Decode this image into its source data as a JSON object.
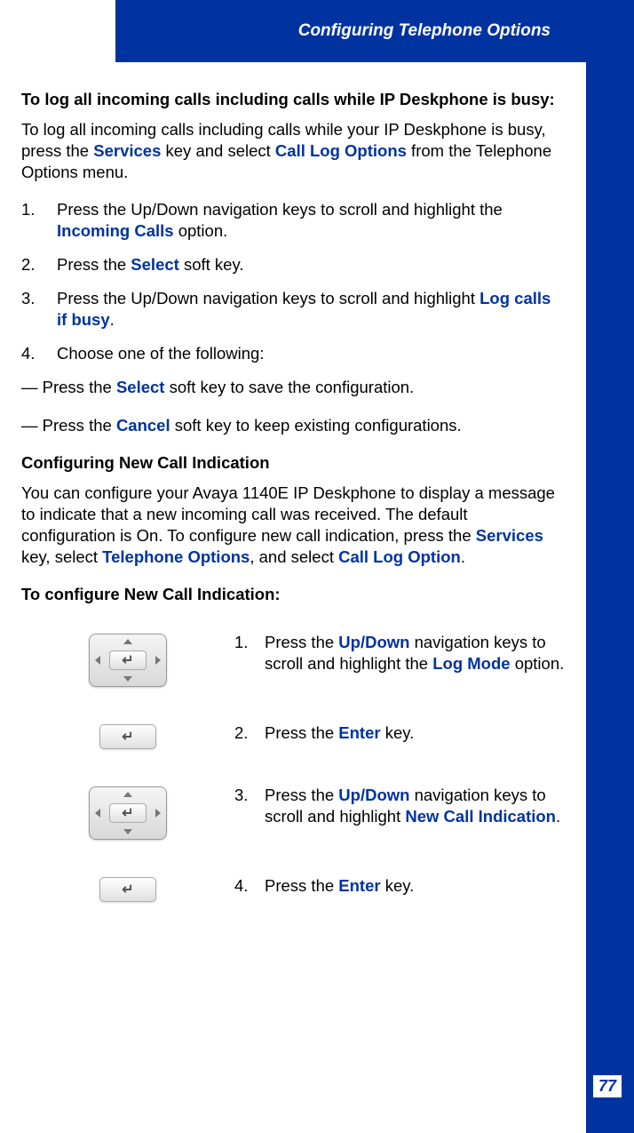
{
  "header": {
    "title": "Configuring Telephone Options"
  },
  "section1": {
    "heading": "To log all incoming calls including calls while IP Deskphone is busy:",
    "intro_pre": "To log all incoming calls including calls while your IP Deskphone is busy, press the ",
    "intro_t1": "Services",
    "intro_mid": " key and select ",
    "intro_t2": "Call Log Options",
    "intro_post": " from the Telephone Options menu.",
    "steps": [
      {
        "pre": "Press the Up/Down navigation keys to scroll and highlight the ",
        "term": "Incoming Calls",
        "post": " option."
      },
      {
        "pre": "Press the ",
        "term": "Select",
        "post": " soft key."
      },
      {
        "pre": "Press the Up/Down navigation keys to scroll and highlight ",
        "term": "Log calls if busy",
        "post": "."
      },
      {
        "pre": "Choose one of the following:",
        "term": "",
        "post": ""
      }
    ],
    "dash1_pre": "— Press the ",
    "dash1_term": "Select",
    "dash1_post": " soft key to save the configuration.",
    "dash2_pre": "— Press the ",
    "dash2_term": "Cancel",
    "dash2_post": " soft key to keep existing configurations."
  },
  "section2": {
    "heading": "Configuring New Call Indication",
    "intro_pre": "You can configure your Avaya 1140E IP Deskphone to display a message to indicate that a new incoming call was received. The default configuration is On. To configure new call indication, press the ",
    "intro_t1": "Services",
    "intro_mid1": " key, select ",
    "intro_t2": "Telephone Options",
    "intro_mid2": ", and select ",
    "intro_t3": "Call Log Option",
    "intro_post": ".",
    "subheading": "To configure New Call Indication:",
    "steps": [
      {
        "num": "1.",
        "pre": "Press the ",
        "term1": "Up/Down",
        "mid": " navigation keys to scroll and highlight the ",
        "term2": "Log Mode",
        "post": " option."
      },
      {
        "num": "2.",
        "pre": "Press the ",
        "term1": "Enter",
        "mid": " key.",
        "term2": "",
        "post": ""
      },
      {
        "num": "3.",
        "pre": "Press the ",
        "term1": "Up/Down",
        "mid": " navigation keys to scroll and highlight ",
        "term2": "New Call Indication",
        "post": "."
      },
      {
        "num": "4.",
        "pre": "Press the ",
        "term1": "Enter",
        "mid": " key.",
        "term2": "",
        "post": ""
      }
    ]
  },
  "page_number": "77"
}
